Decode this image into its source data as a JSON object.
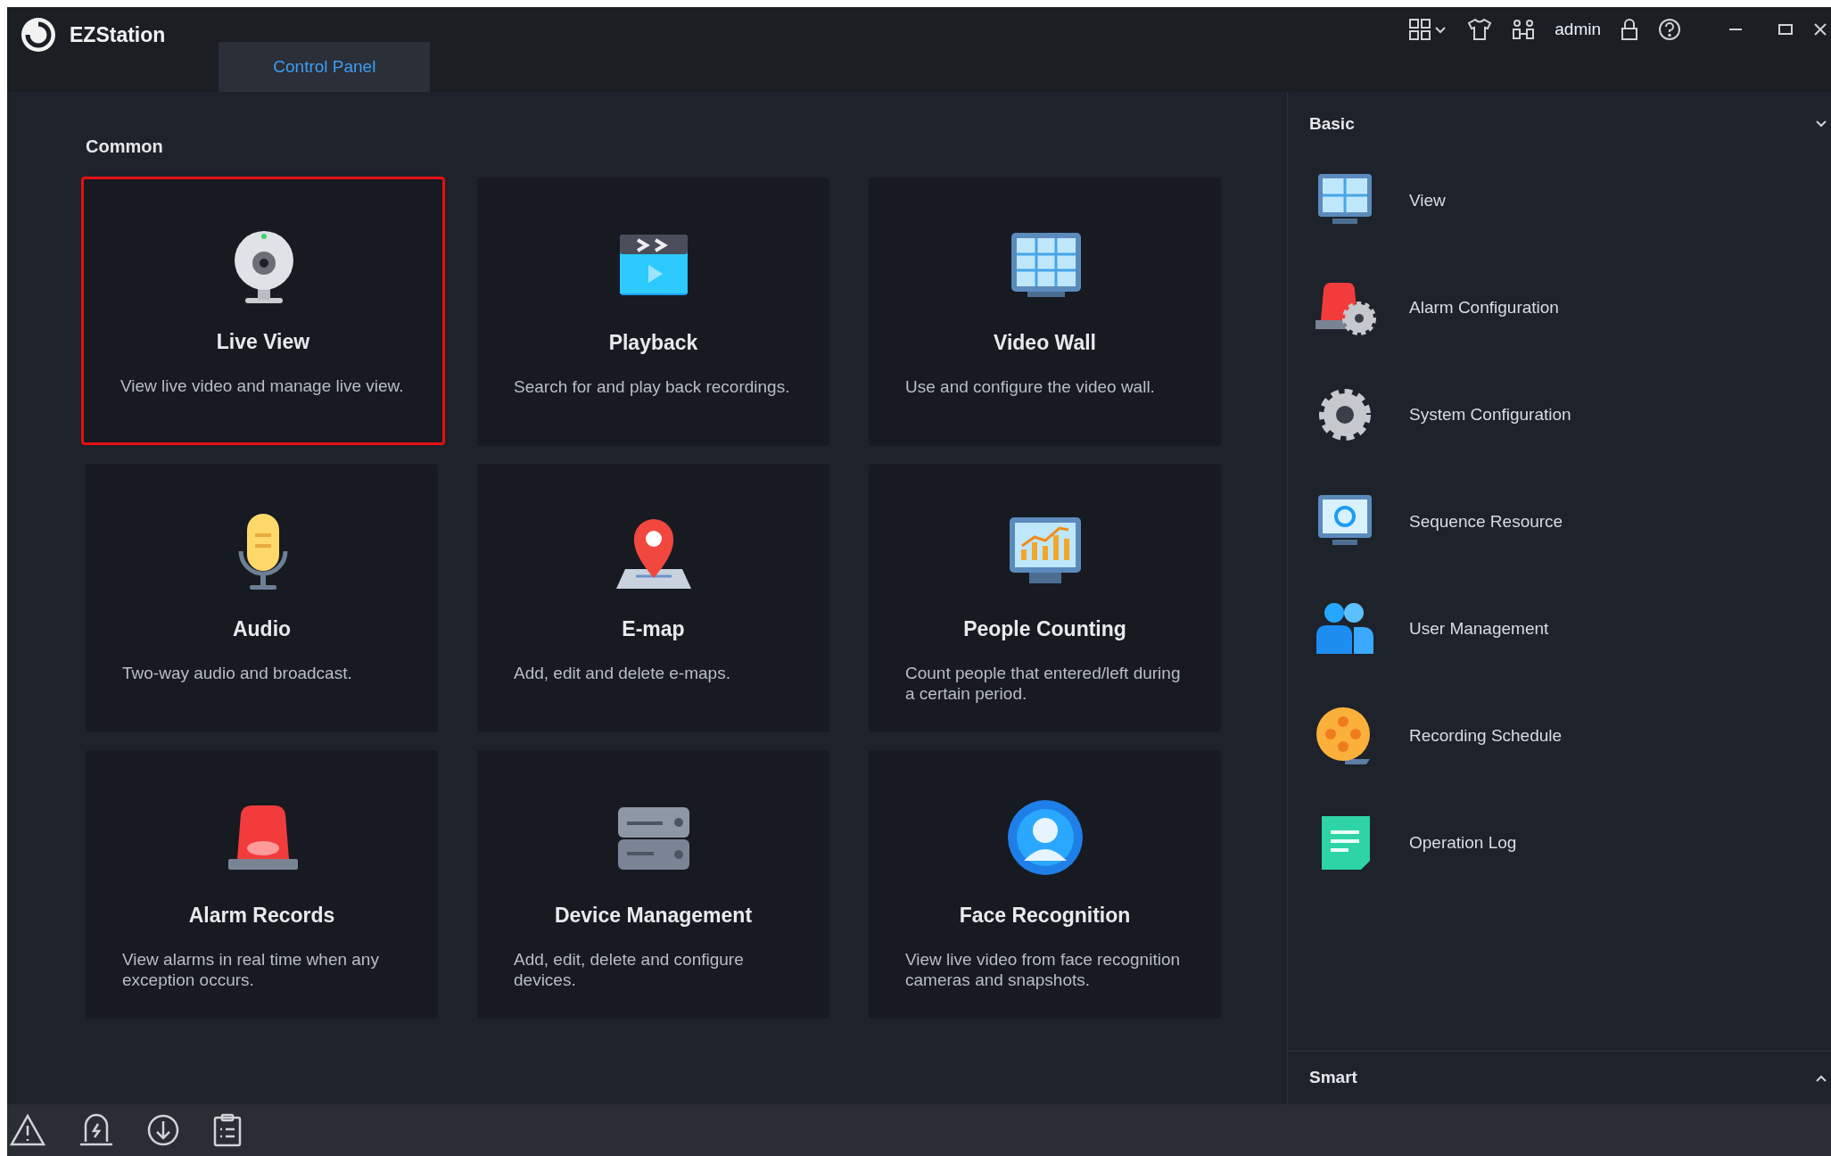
{
  "app": {
    "name": "EZStation"
  },
  "tabs": [
    {
      "label": "Control Panel",
      "selected": true
    }
  ],
  "user": {
    "name": "admin"
  },
  "common": {
    "title": "Common",
    "cards": [
      {
        "kind": "camera",
        "title": "Live View",
        "description": "View live video and manage live view.",
        "selected": true
      },
      {
        "kind": "playback",
        "title": "Playback",
        "description": "Search for and play back recordings.",
        "selected": false
      },
      {
        "kind": "videowall",
        "title": "Video Wall",
        "description": "Use and configure the video wall.",
        "selected": false
      },
      {
        "kind": "microphone",
        "title": "Audio",
        "description": "Two-way audio and broadcast.",
        "selected": false
      },
      {
        "kind": "map",
        "title": "E-map",
        "description": "Add, edit and delete e-maps.",
        "selected": false
      },
      {
        "kind": "chart",
        "title": "People Counting",
        "description": "Count people that entered/left during a certain period.",
        "selected": false
      },
      {
        "kind": "siren",
        "title": "Alarm Records",
        "description": "View alarms in real time when any exception occurs.",
        "selected": false
      },
      {
        "kind": "server",
        "title": "Device Management",
        "description": "Add, edit, delete and configure devices.",
        "selected": false
      },
      {
        "kind": "face",
        "title": "Face Recognition",
        "description": "View live video from face recognition cameras and snapshots.",
        "selected": false
      }
    ]
  },
  "basic": {
    "title": "Basic",
    "expanded": true,
    "items": [
      {
        "kind": "monitor",
        "label": "View"
      },
      {
        "kind": "siren-gear",
        "label": "Alarm Configuration"
      },
      {
        "kind": "gear",
        "label": "System Configuration"
      },
      {
        "kind": "monitor-refresh",
        "label": "Sequence Resource"
      },
      {
        "kind": "users",
        "label": "User Management"
      },
      {
        "kind": "reel",
        "label": "Recording Schedule"
      },
      {
        "kind": "note",
        "label": "Operation Log"
      }
    ]
  },
  "smart": {
    "title": "Smart",
    "expanded": false
  }
}
